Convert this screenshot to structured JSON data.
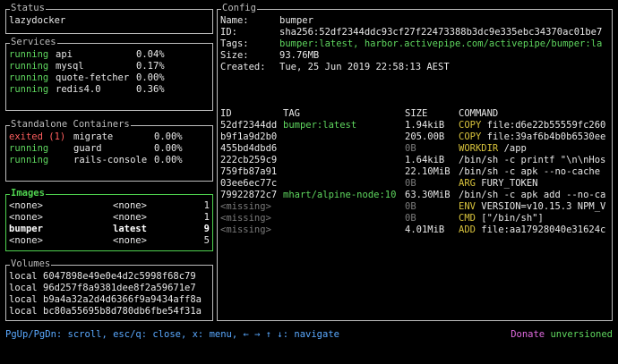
{
  "status": {
    "title": "Status",
    "app_name": "lazydocker"
  },
  "services": {
    "title": "Services",
    "items": [
      {
        "state": "running",
        "name": "api",
        "cpu": "0.04%"
      },
      {
        "state": "running",
        "name": "mysql",
        "cpu": "0.17%"
      },
      {
        "state": "running",
        "name": "quote-fetcher",
        "cpu": "0.00%"
      },
      {
        "state": "running",
        "name": "redis4.0",
        "cpu": "0.36%"
      }
    ]
  },
  "standalone": {
    "title": "Standalone Containers",
    "items": [
      {
        "state": "exited (1)",
        "name": "migrate",
        "cpu": "0.00%"
      },
      {
        "state": "running",
        "name": "guard",
        "cpu": "0.00%"
      },
      {
        "state": "running",
        "name": "rails-console",
        "cpu": "0.00%"
      }
    ]
  },
  "images": {
    "title": "Images",
    "items": [
      {
        "repo": "<none>",
        "tag": "<none>",
        "count": "1"
      },
      {
        "repo": "<none>",
        "tag": "<none>",
        "count": "1"
      },
      {
        "repo": "bumper",
        "tag": "latest",
        "count": "9"
      },
      {
        "repo": "<none>",
        "tag": "<none>",
        "count": "5"
      }
    ]
  },
  "volumes": {
    "title": "Volumes",
    "items": [
      {
        "driver": "local",
        "name": "6047898e49e0e4d2c5998f68c79"
      },
      {
        "driver": "local",
        "name": "96d257f8a9381dee8f2a59671e7"
      },
      {
        "driver": "local",
        "name": "b9a4a32a2d4d6366f9a9434aff8a"
      },
      {
        "driver": "local",
        "name": "bc80a55695b8d780db6fbe54f31a"
      }
    ]
  },
  "config": {
    "title": "Config",
    "fields": [
      {
        "label": "Name:",
        "value": "bumper"
      },
      {
        "label": "ID:",
        "value": "sha256:52df2344ddc93cf27f22473388b3dc9e335ebc34370ac01be7"
      },
      {
        "label": "Tags:",
        "value": "bumper:latest, harbor.activepipe.com/activepipe/bumper:la"
      },
      {
        "label": "Size:",
        "value": "93.76MB"
      },
      {
        "label": "Created:",
        "value": "Tue, 25 Jun 2019 22:58:13 AEST"
      }
    ],
    "history_headers": {
      "id": "ID",
      "tag": "TAG",
      "size": "SIZE",
      "command": "COMMAND"
    },
    "history": [
      {
        "id": "52df2344dd",
        "tag": "bumper:latest",
        "size": "1.94kiB",
        "cmd_kw": "COPY",
        "cmd_rest": " file:d6e22b55559fc260"
      },
      {
        "id": "b9f1a9d2b0",
        "tag": "",
        "size": "205.00B",
        "cmd_kw": "COPY",
        "cmd_rest": " file:39af6b4b0b6530ee"
      },
      {
        "id": "455bd4dbd6",
        "tag": "",
        "size": "0B",
        "cmd_kw": "WORKDIR",
        "cmd_rest": " /app"
      },
      {
        "id": "222cb259c9",
        "tag": "",
        "size": "1.64kiB",
        "cmd_kw": "",
        "cmd_rest": "/bin/sh -c printf \"\\n\\nHos"
      },
      {
        "id": "759fb87a91",
        "tag": "",
        "size": "22.10MiB",
        "cmd_kw": "",
        "cmd_rest": "/bin/sh -c apk --no-cache"
      },
      {
        "id": "03ee6ec77c",
        "tag": "",
        "size": "0B",
        "cmd_kw": "ARG",
        "cmd_rest": " FURY_TOKEN"
      },
      {
        "id": "79922872c7",
        "tag": "mhart/alpine-node:10",
        "size": "63.30MiB",
        "cmd_kw": "",
        "cmd_rest": "/bin/sh -c apk add --no-ca"
      },
      {
        "id": "<missing>",
        "tag": "",
        "size": "0B",
        "cmd_kw": "ENV",
        "cmd_rest": " VERSION=v10.15.3 NPM_V"
      },
      {
        "id": "<missing>",
        "tag": "",
        "size": "0B",
        "cmd_kw": "CMD",
        "cmd_rest": " [\"/bin/sh\"]"
      },
      {
        "id": "<missing>",
        "tag": "",
        "size": "4.01MiB",
        "cmd_kw": "ADD",
        "cmd_rest": " file:aa17928040e31624c"
      }
    ]
  },
  "footer": {
    "hint": "PgUp/PgDn: scroll, esc/q: close, x: menu, ← → ↑ ↓: navigate",
    "donate": "Donate",
    "unversioned": "unversioned"
  },
  "colors": {
    "active_border": "#4fd24f",
    "border": "#bdbdbd",
    "running": "#5fd75f",
    "exited": "#ff5f5f",
    "keyword": "#d7c23c",
    "hint": "#5aa9ff",
    "donate": "#e06adf"
  }
}
